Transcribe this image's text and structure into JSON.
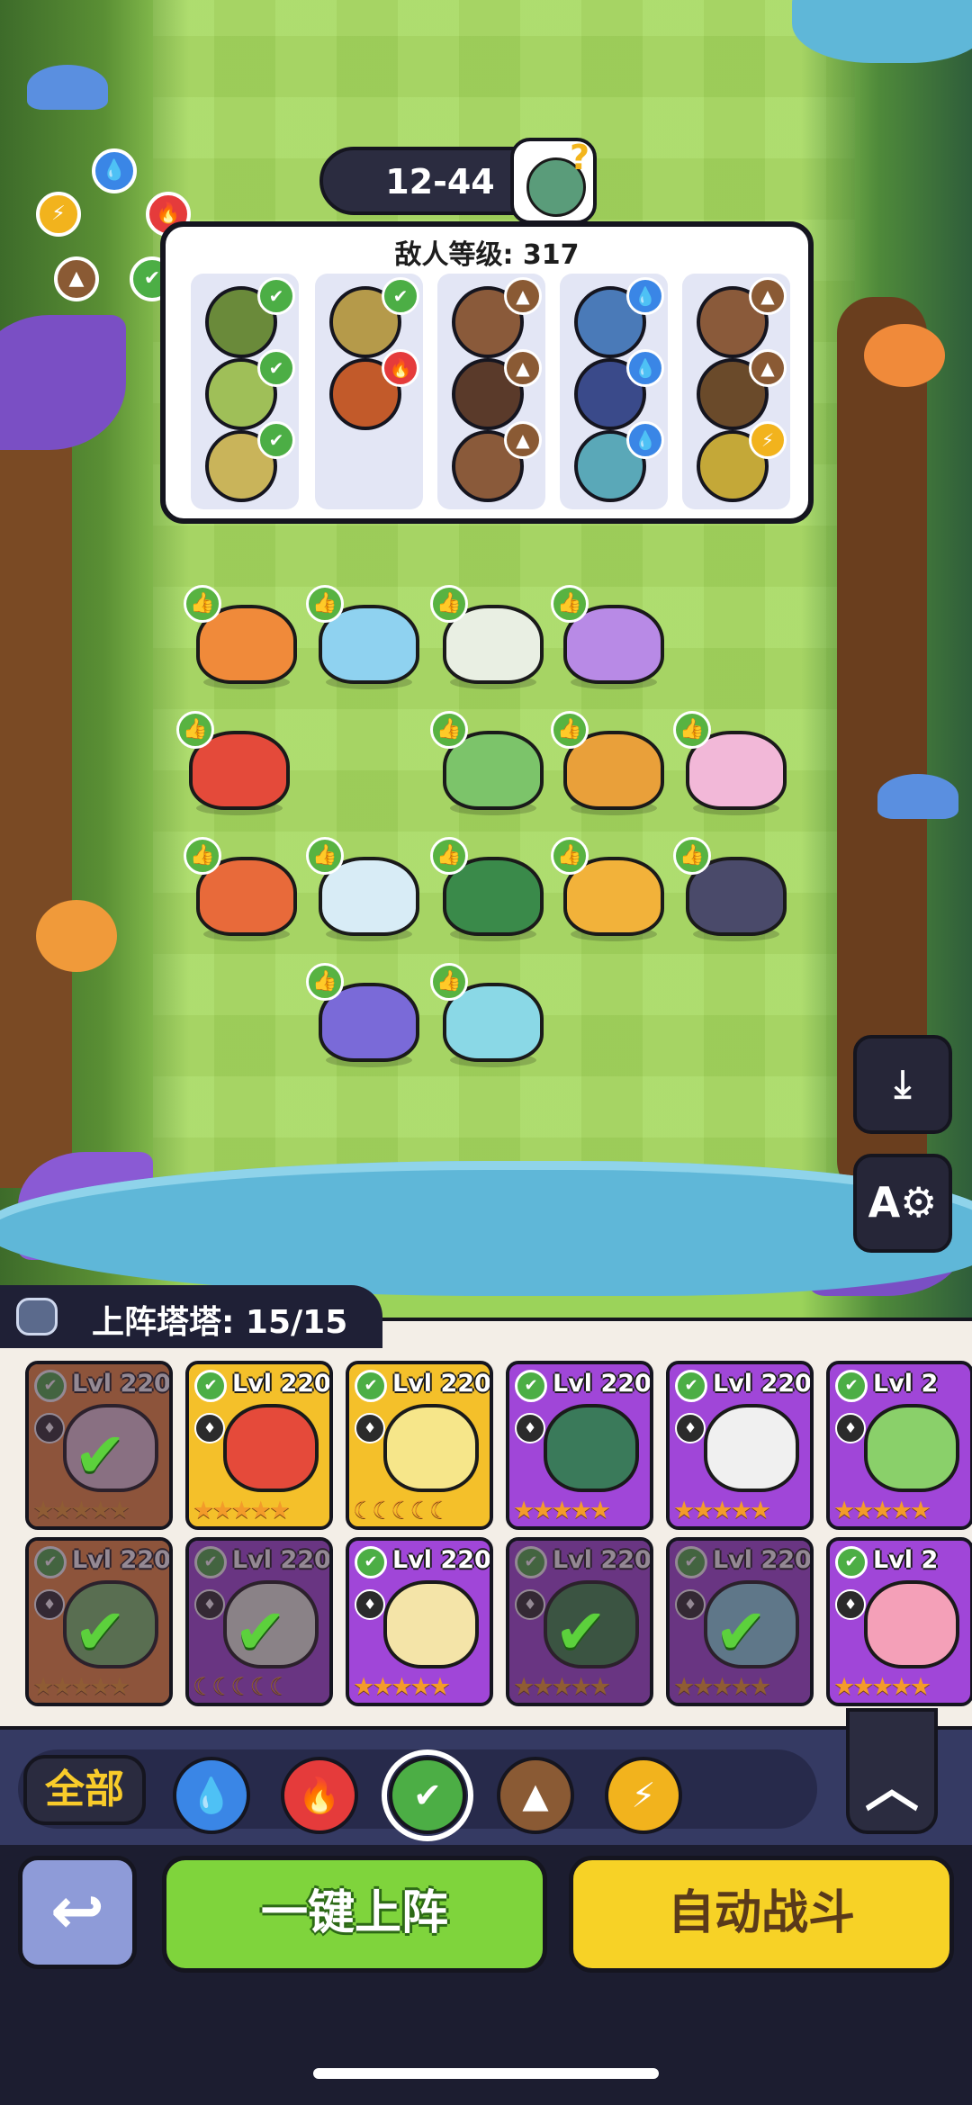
{
  "stage": {
    "label": "12-44"
  },
  "enemy_panel": {
    "title": "敌人等级: 317",
    "columns": [
      {
        "faces": [
          "#6a8a3a",
          "#9fbf58",
          "#c9b45a"
        ],
        "badges": [
          "leaf",
          "leaf",
          "leaf"
        ]
      },
      {
        "faces": [
          "#b59a4a",
          "#c25a2a"
        ],
        "badges": [
          "leaf",
          "fire"
        ]
      },
      {
        "faces": [
          "#8a5a3a",
          "#5a3a2a",
          "#8a5a3a"
        ],
        "badges": [
          "rock",
          "rock",
          "rock"
        ]
      },
      {
        "faces": [
          "#4a7ab8",
          "#3a4a8a",
          "#5aa8b8"
        ],
        "badges": [
          "water",
          "water",
          "water"
        ]
      },
      {
        "faces": [
          "#8a5a3a",
          "#6a4a2a",
          "#c4a838"
        ],
        "badges": [
          "rock",
          "rock",
          "bolt"
        ]
      }
    ]
  },
  "element_colors": {
    "water": "#3a86e6",
    "fire": "#e53b3b",
    "leaf": "#4cae45",
    "rock": "#8a5a34",
    "bolt": "#f2b31d"
  },
  "deployed_units": [
    {
      "color": "#f08a3a"
    },
    {
      "color": "#8fd2f0"
    },
    {
      "color": "#e9efe3"
    },
    {
      "color": "#b88ae6"
    },
    {
      "color": "#e44a3a"
    },
    {
      "color": "#7cc46a"
    },
    {
      "color": "#e9a03a"
    },
    {
      "color": "#f2b8d8"
    },
    {
      "color": "#e86a3a"
    },
    {
      "color": "#d8ecf6"
    },
    {
      "color": "#3a8a4a"
    },
    {
      "color": "#f2b23a"
    },
    {
      "color": "#4a4a6a"
    },
    {
      "color": "#7a6ad8"
    },
    {
      "color": "#8ad8e6"
    }
  ],
  "roster": {
    "label": "上阵塔塔: 15/15",
    "cards": [
      {
        "level": "Lvl 220",
        "bg": "#f08a3a",
        "pet": "#e6c8d8",
        "deployed": true
      },
      {
        "level": "Lvl 220",
        "bg": "#f4c02a",
        "pet": "#e54a3a",
        "deployed": false
      },
      {
        "level": "Lvl 220",
        "bg": "#f4c02a",
        "pet": "#f6e68a",
        "deployed": false,
        "stars": "moons"
      },
      {
        "level": "Lvl 220",
        "bg": "#a046d8",
        "pet": "#3a7a5a",
        "deployed": false
      },
      {
        "level": "Lvl 220",
        "bg": "#a046d8",
        "pet": "#f0f0f0",
        "deployed": false
      },
      {
        "level": "Lvl 2",
        "bg": "#a046d8",
        "pet": "#8ad06a",
        "deployed": false
      },
      {
        "level": "Lvl 220",
        "bg": "#f08a3a",
        "pet": "#7cc46a",
        "deployed": true
      },
      {
        "level": "Lvl 220",
        "bg": "#a046d8",
        "pet": "#e9efe3",
        "deployed": true,
        "stars": "moons"
      },
      {
        "level": "Lvl 220",
        "bg": "#a046d8",
        "pet": "#f4e4a8",
        "deployed": false
      },
      {
        "level": "Lvl 220",
        "bg": "#a046d8",
        "pet": "#3a8a4a",
        "deployed": true
      },
      {
        "level": "Lvl 220",
        "bg": "#a046d8",
        "pet": "#8ad8e6",
        "deployed": true
      },
      {
        "level": "Lvl 2",
        "bg": "#a046d8",
        "pet": "#f4a0b8",
        "deployed": false
      }
    ]
  },
  "filters": {
    "all_label": "全部",
    "elements": [
      "water",
      "fire",
      "leaf",
      "rock",
      "bolt"
    ],
    "selected": "leaf"
  },
  "buttons": {
    "auto_deploy": "一键上阵",
    "auto_battle": "自动战斗"
  }
}
